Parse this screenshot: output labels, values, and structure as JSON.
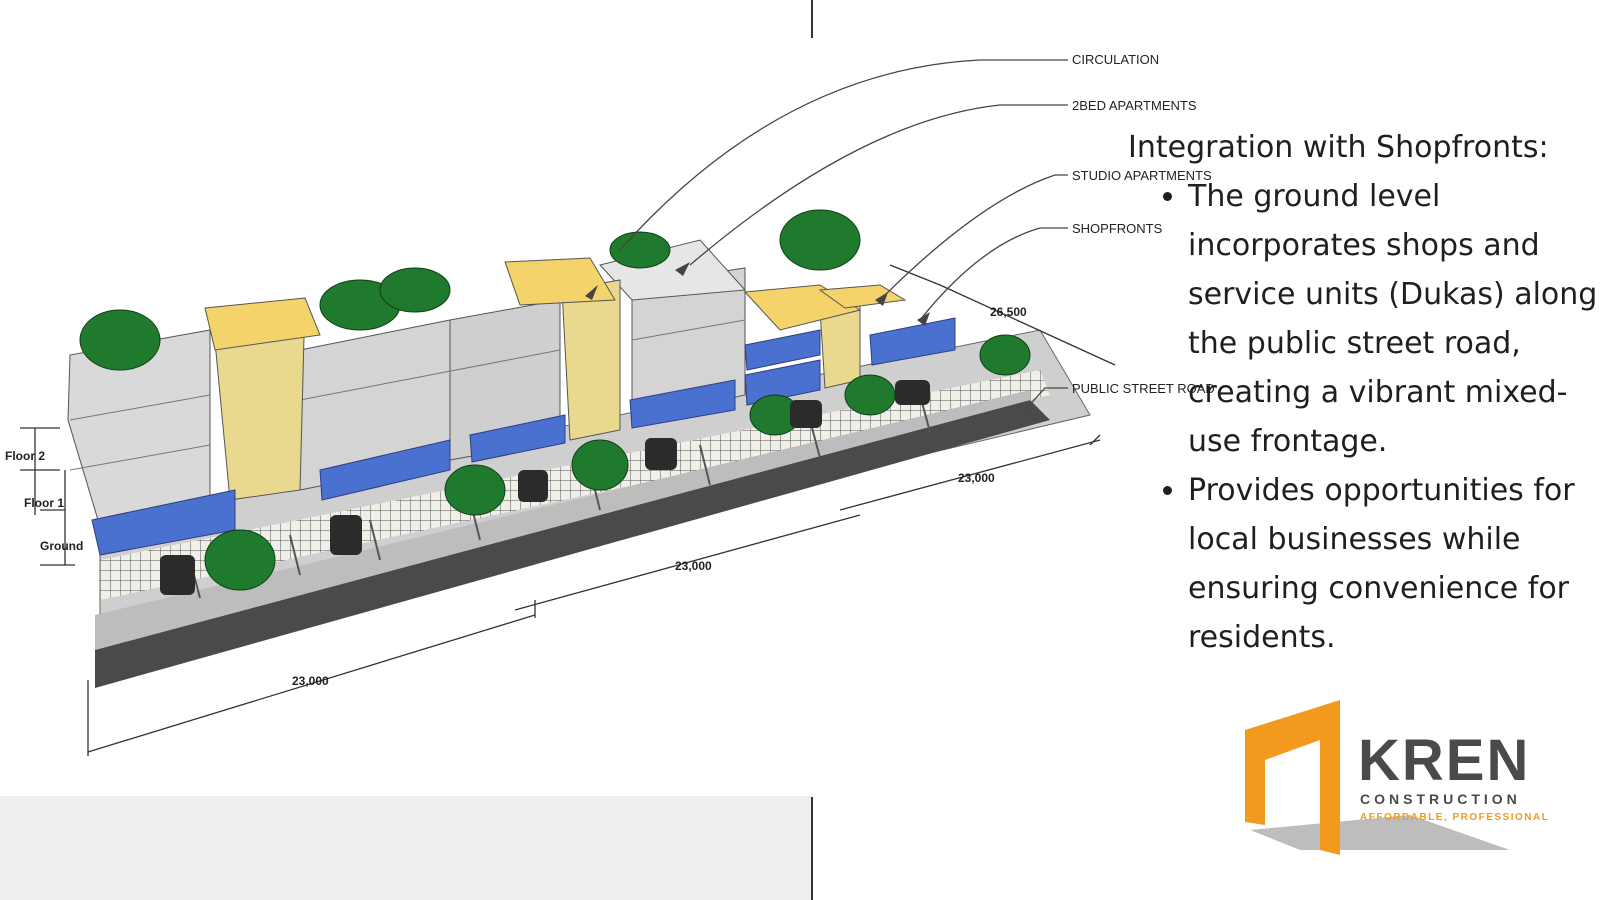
{
  "callouts": {
    "circulation": "CIRCULATION",
    "twobed": "2BED APARTMENTS",
    "studio": "STUDIO APARTMENTS",
    "shopfronts": "SHOPFRONTS",
    "street": "PUBLIC STREET ROAD"
  },
  "levels": {
    "floor2": "Floor 2",
    "floor1": "Floor 1",
    "ground": "Ground"
  },
  "dimensions": {
    "front": "23,000",
    "middle": "23,000",
    "back": "23,000",
    "depth": "26,500"
  },
  "content": {
    "heading": "Integration with Shopfronts:",
    "bullets": [
      "The ground level incorporates shops and service units (Dukas) along the public street road, creating a vibrant mixed-use frontage.",
      "Provides opportunities for local businesses while ensuring convenience for residents."
    ]
  },
  "logo": {
    "name": "KREN",
    "sub": "CONSTRUCTION",
    "tagline": "AFFORDABLE, PROFESSIONAL"
  },
  "colors": {
    "circulation": "#f3d36a",
    "apartments": "#d6d6d6",
    "shopfronts": "#4a70d0",
    "trees": "#1f7a2e",
    "road": "#4a4a4a",
    "logo_orange": "#f39a1e",
    "logo_grey": "#4a4a4a"
  }
}
